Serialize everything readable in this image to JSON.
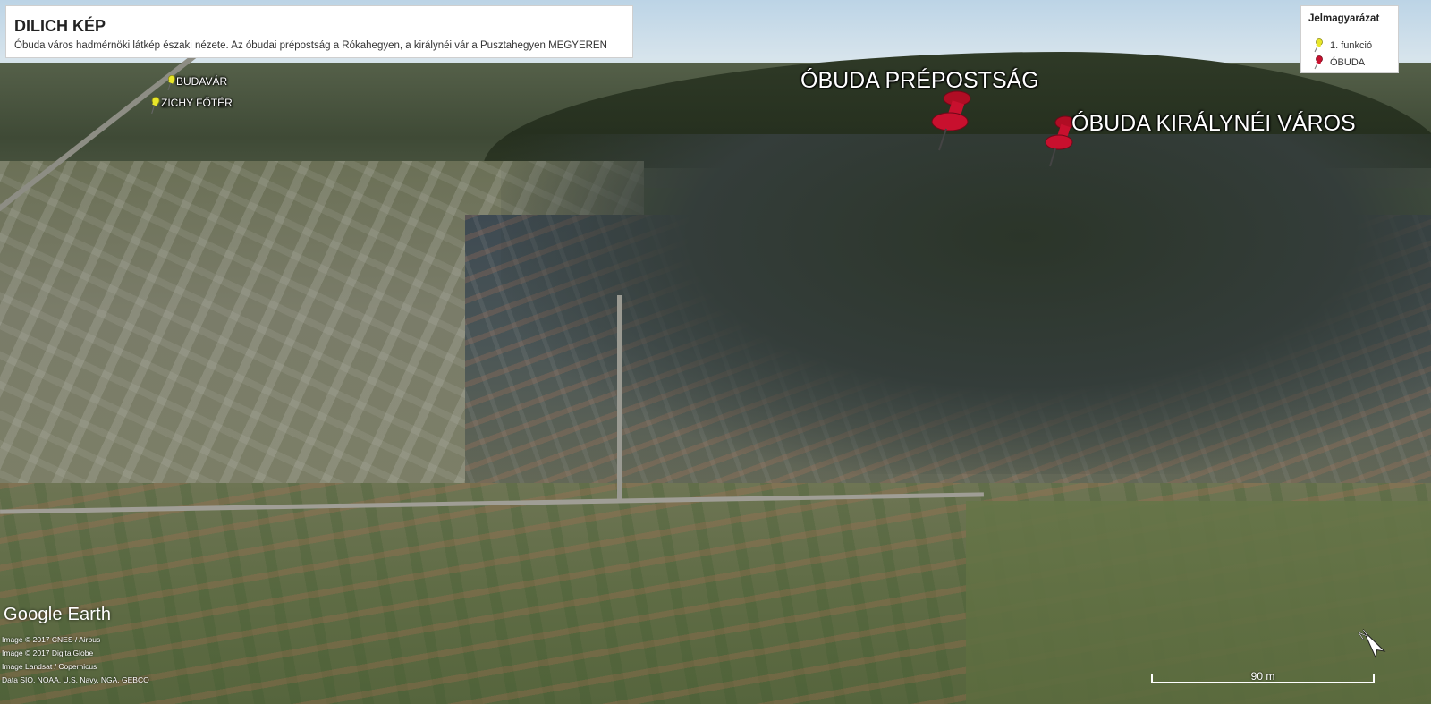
{
  "panel": {
    "title": "DILICH KÉP",
    "description": "Óbuda város hadmérnöki látkép északi nézete. Az óbudai prépostság a Rókahegyen, a királynéi vár a Pusztahegyen MEGYEREN"
  },
  "legend": {
    "title": "Jelmagyarázat",
    "items": [
      {
        "label": "1. funkció",
        "icon": "yellow-pushpin-icon",
        "color": "#e8e62a"
      },
      {
        "label": "ÓBUDA",
        "icon": "red-pushpin-icon",
        "color": "#c8102e"
      }
    ]
  },
  "placemarks": [
    {
      "label": "BUDAVÁR",
      "icon": "yellow-pushpin-icon",
      "color": "#e8e62a"
    },
    {
      "label": "ZICHY FŐTÉR",
      "icon": "yellow-pushpin-icon",
      "color": "#e8e62a"
    },
    {
      "label": "ÓBUDA PRÉPOSTSÁG",
      "icon": "red-pushpin-icon",
      "color": "#c8102e"
    },
    {
      "label": "ÓBUDA KIRÁLYNÉI VÁROS",
      "icon": "red-pushpin-icon",
      "color": "#c8102e"
    }
  ],
  "attribution": {
    "logo": "Google Earth",
    "credits": [
      "Image © 2017 CNES / Airbus",
      "Image © 2017 DigitalGlobe",
      "Image Landsat / Copernicus",
      "Data SIO, NOAA, U.S. Navy, NGA, GEBCO"
    ]
  },
  "scale": {
    "label": "90 m"
  },
  "compass": {
    "icon": "north-compass-icon",
    "letter": "N"
  }
}
